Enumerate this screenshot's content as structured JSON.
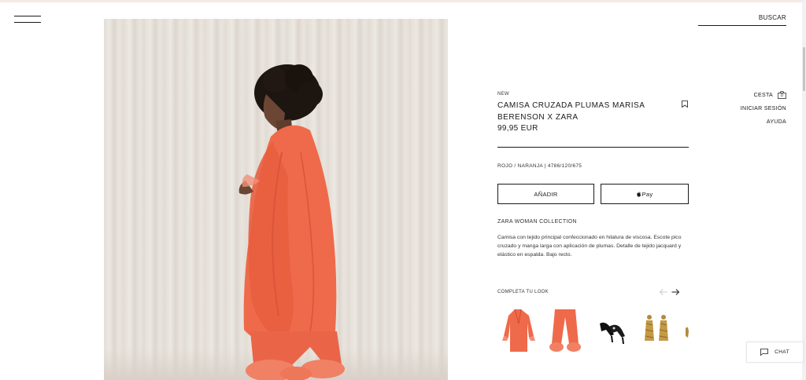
{
  "header": {
    "search_label": "BUSCAR"
  },
  "product": {
    "badge": "NEW",
    "title": "CAMISA CRUZADA PLUMAS MARISA BERENSON X ZARA",
    "price": "99,95 EUR",
    "color_ref": "ROJO / NARANJA | 4786/120/675",
    "add_label": "AÑADIR",
    "pay_label": "Pay",
    "collection": "ZARA WOMAN COLLECTION",
    "description": "Camisa con tejido principal confeccionado en hilatura de viscosa. Escote pico cruzado y manga larga con aplicación de plumas. Detalle de tejido jacquard y elástico en espalda. Bajo recto.",
    "accent_color": "#ef6a4a"
  },
  "complete_look": {
    "label": "COMPLETA TU LOOK",
    "items": [
      {
        "icon": "kimono-shirt-thumbnail"
      },
      {
        "icon": "feather-trousers-thumbnail"
      },
      {
        "icon": "black-heels-thumbnail"
      },
      {
        "icon": "gold-earrings-thumbnail"
      },
      {
        "icon": "partial-item-thumbnail"
      }
    ]
  },
  "nav": {
    "cart_label": "CESTA",
    "cart_count": "0",
    "login_label": "INICIAR SESIÓN",
    "help_label": "AYUDA"
  },
  "chat": {
    "label": "CHAT"
  }
}
